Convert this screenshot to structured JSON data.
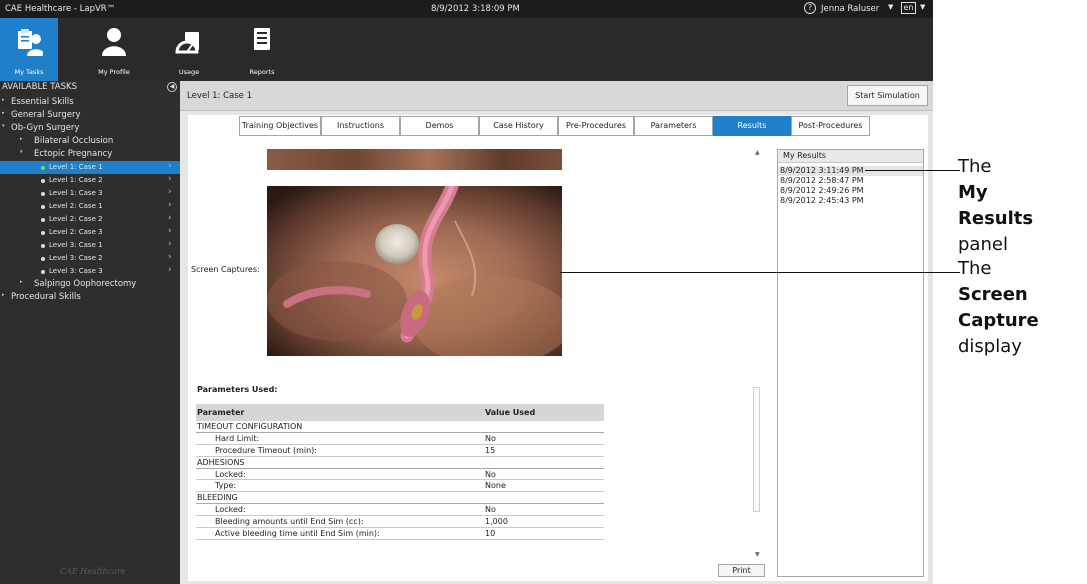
{
  "window": {
    "title": "CAE Healthcare - LapVR™",
    "datetime": "8/9/2012 3:18:09 PM",
    "help_glyph": "?",
    "user": "Jenna Raluser",
    "language": "en"
  },
  "nav": {
    "items": [
      {
        "label": "My Tasks",
        "icon": "my-tasks-icon",
        "active": true
      },
      {
        "label": "My Profile",
        "icon": "profile-icon",
        "active": false
      },
      {
        "label": "Usage",
        "icon": "usage-icon",
        "active": false
      },
      {
        "label": "Reports",
        "icon": "reports-icon",
        "active": false
      }
    ]
  },
  "sidebar": {
    "header": "AVAILABLE TASKS",
    "tree": [
      {
        "label": "Essential Skills",
        "level": 0,
        "arrow": "▸"
      },
      {
        "label": "General Surgery",
        "level": 0,
        "arrow": "▸"
      },
      {
        "label": "Ob-Gyn Surgery",
        "level": 0,
        "arrow": "▾"
      },
      {
        "label": "Bilateral Occlusion",
        "level": 1,
        "arrow": "▸"
      },
      {
        "label": "Ectopic Pregnancy",
        "level": 1,
        "arrow": "▾"
      },
      {
        "label": "Level 1: Case 1",
        "level": 2,
        "selected": true
      },
      {
        "label": "Level 1: Case 2",
        "level": 2
      },
      {
        "label": "Level 1: Case 3",
        "level": 2
      },
      {
        "label": "Level 2: Case 1",
        "level": 2
      },
      {
        "label": "Level 2: Case 2",
        "level": 2
      },
      {
        "label": "Level 2: Case 3",
        "level": 2
      },
      {
        "label": "Level 3: Case 1",
        "level": 2
      },
      {
        "label": "Level 3: Case 2",
        "level": 2
      },
      {
        "label": "Level 3: Case 3",
        "level": 2
      },
      {
        "label": "Salpingo Oophorectomy",
        "level": 1,
        "arrow": "▸"
      },
      {
        "label": "Procedural Skills",
        "level": 0,
        "arrow": "▸"
      }
    ],
    "logo": "CAE Healthcare"
  },
  "main": {
    "case_title": "Level 1: Case 1",
    "start_button": "Start Simulation",
    "tabs": [
      {
        "label": "Training Objectives",
        "active": false
      },
      {
        "label": "Instructions",
        "active": false
      },
      {
        "label": "Demos",
        "active": false
      },
      {
        "label": "Case History",
        "active": false
      },
      {
        "label": "Pre-Procedures",
        "active": false
      },
      {
        "label": "Parameters",
        "active": false
      },
      {
        "label": "Results",
        "active": true
      },
      {
        "label": "Post-Procedures",
        "active": false
      }
    ],
    "screen_captures_label": "Screen Captures:",
    "params_title": "Parameters Used:",
    "param_headers": {
      "name": "Parameter",
      "value": "Value Used"
    },
    "params": [
      {
        "name": "TIMEOUT CONFIGURATION",
        "value": "",
        "section": true
      },
      {
        "name": "Hard Limit:",
        "value": "No"
      },
      {
        "name": "Procedure Timeout (min):",
        "value": "15"
      },
      {
        "name": "ADHESIONS",
        "value": "",
        "section": true
      },
      {
        "name": "Locked:",
        "value": "No"
      },
      {
        "name": "Type:",
        "value": "None"
      },
      {
        "name": "BLEEDING",
        "value": "",
        "section": true
      },
      {
        "name": "Locked:",
        "value": "No"
      },
      {
        "name": "Bleeding amounts until End Sim (cc):",
        "value": "1,000"
      },
      {
        "name": "Active bleeding time until End Sim (min):",
        "value": "10"
      }
    ],
    "print_button": "Print"
  },
  "results": {
    "title": "My Results",
    "items": [
      {
        "label": "8/9/2012 3:11:49 PM",
        "selected": true
      },
      {
        "label": "8/9/2012 2:58:47 PM",
        "selected": false
      },
      {
        "label": "8/9/2012 2:49:26 PM",
        "selected": false
      },
      {
        "label": "8/9/2012 2:45:43 PM",
        "selected": false
      }
    ]
  },
  "annotations": {
    "my_results": {
      "prefix": "The ",
      "bold": "My Results",
      "suffix": "panel"
    },
    "screen_capture": {
      "prefix": "The ",
      "bold": "Screen Capture",
      "suffix": "display"
    }
  },
  "colors": {
    "accent": "#1f7fc9",
    "sidebar_bg": "#2e2e2e",
    "titlebar_bg": "#1c1c1c",
    "selected_bullet": "#7ed957"
  }
}
